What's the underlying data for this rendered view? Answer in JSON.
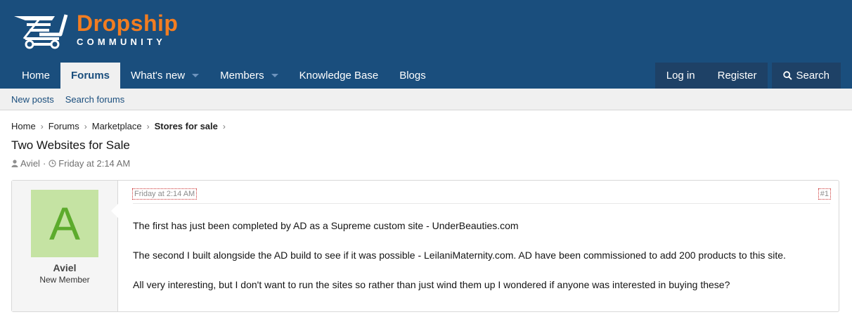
{
  "brand": {
    "title": "Dropship",
    "subtitle": "COMMUNITY",
    "title_color": "#f27d21",
    "header_color": "#1a4e7d"
  },
  "nav": {
    "items": [
      {
        "label": "Home"
      },
      {
        "label": "Forums"
      },
      {
        "label": "What's new"
      },
      {
        "label": "Members"
      },
      {
        "label": "Knowledge Base"
      },
      {
        "label": "Blogs"
      }
    ],
    "active": "Forums",
    "login": "Log in",
    "register": "Register",
    "search": "Search"
  },
  "subnav": {
    "new_posts": "New posts",
    "search_forums": "Search forums"
  },
  "breadcrumb": [
    "Home",
    "Forums",
    "Marketplace",
    "Stores for sale"
  ],
  "thread": {
    "title": "Two Websites for Sale",
    "author": "Aviel",
    "date": "Friday at 2:14 AM"
  },
  "post": {
    "avatar_letter": "A",
    "avatar_bg": "#c5e3a3",
    "avatar_fg": "#5cab2c",
    "username": "Aviel",
    "user_title": "New Member",
    "date": "Friday at 2:14 AM",
    "number": "#1",
    "paragraphs": [
      "The first has just been completed by AD as a Supreme custom site - UnderBeauties.com",
      "The second I built alongside the AD build to see if it was possible - LeilaniMaternity.com. AD have been commissioned to add 200 products to this site.",
      "All very interesting, but I don't want to run the sites so rather than just wind them up I wondered if anyone was interested in buying these?"
    ]
  }
}
